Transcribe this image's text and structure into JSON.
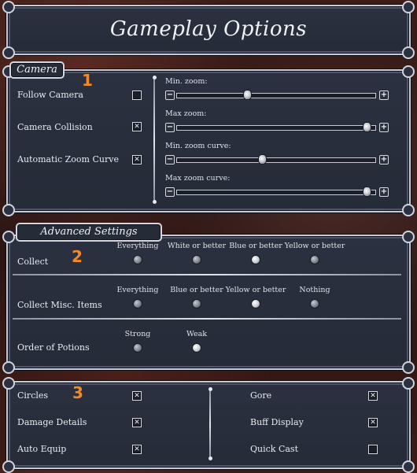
{
  "title": "Gameplay Options",
  "annotations": [
    "1",
    "2",
    "3"
  ],
  "camera": {
    "tab": "Camera",
    "follow_camera": {
      "label": "Follow Camera",
      "checked": false
    },
    "camera_collision": {
      "label": "Camera Collision",
      "checked": true
    },
    "automatic_zoom_curve": {
      "label": "Automatic Zoom Curve",
      "checked": true
    },
    "sliders": [
      {
        "label": "Min. zoom:",
        "value": 0.35
      },
      {
        "label": "Max zoom:",
        "value": 0.98
      },
      {
        "label": "Min. zoom curve:",
        "value": 0.43
      },
      {
        "label": "Max zoom curve:",
        "value": 0.98
      }
    ]
  },
  "advanced": {
    "tab": "Advanced Settings",
    "collect": {
      "label": "Collect",
      "options": [
        "Everything",
        "White or better",
        "Blue or better",
        "Yellow or better"
      ],
      "selected": 2
    },
    "collect_misc": {
      "label": "Collect Misc. Items",
      "options": [
        "Everything",
        "Blue or better",
        "Yellow or better",
        "Nothing"
      ],
      "selected": 2
    },
    "order_of_potions": {
      "label": "Order of Potions",
      "options": [
        "Strong",
        "Weak"
      ],
      "selected": 1
    }
  },
  "display": {
    "circles": {
      "label": "Circles",
      "checked": true
    },
    "damage_details": {
      "label": "Damage Details",
      "checked": true
    },
    "auto_equip": {
      "label": "Auto Equip",
      "checked": true
    },
    "gore": {
      "label": "Gore",
      "checked": true
    },
    "buff_display": {
      "label": "Buff Display",
      "checked": true
    },
    "quick_cast": {
      "label": "Quick Cast",
      "checked": false
    }
  },
  "colors": {
    "accent": "#f08a2a",
    "panel": "#2b3140",
    "border": "#c9ccd6"
  }
}
